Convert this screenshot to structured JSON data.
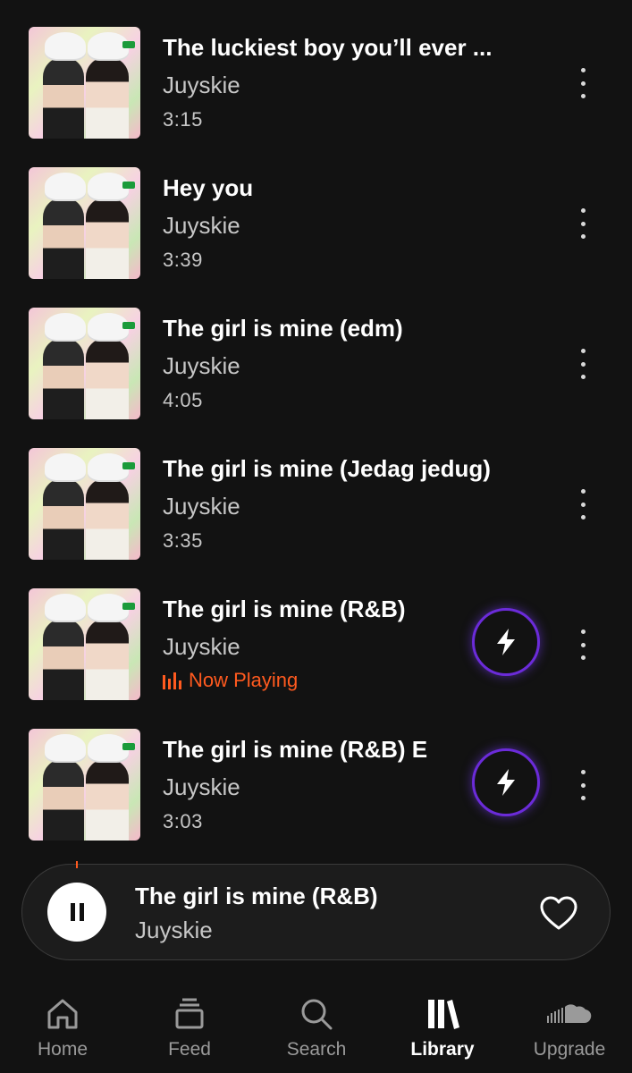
{
  "tracks": [
    {
      "title": "The luckiest boy you’ll ever ...",
      "artist": "Juyskie",
      "duration": "3:15"
    },
    {
      "title": "Hey you",
      "artist": "Juyskie",
      "duration": "3:39"
    },
    {
      "title": "The girl is mine (edm)",
      "artist": "Juyskie",
      "duration": "4:05"
    },
    {
      "title": "The girl is mine (Jedag jedug)",
      "artist": "Juyskie",
      "duration": "3:35"
    },
    {
      "title": "The girl is mine (R&B)",
      "artist": "Juyskie",
      "status": "Now Playing",
      "boost_icon": "lightning-icon"
    },
    {
      "title": "The girl is mine (R&B) E",
      "artist": "Juyskie",
      "duration": "3:03",
      "boost_icon": "lightning-icon"
    }
  ],
  "mini_player": {
    "title": "The girl is mine (R&B)",
    "artist": "Juyskie",
    "play_state_icon": "pause-icon",
    "like_icon": "heart-outline-icon"
  },
  "nav": {
    "home": "Home",
    "feed": "Feed",
    "search": "Search",
    "library": "Library",
    "upgrade": "Upgrade",
    "active": "Library"
  },
  "colors": {
    "background": "#121212",
    "now_playing": "#ff5a1f",
    "boost_ring": "#6b2bd9"
  }
}
